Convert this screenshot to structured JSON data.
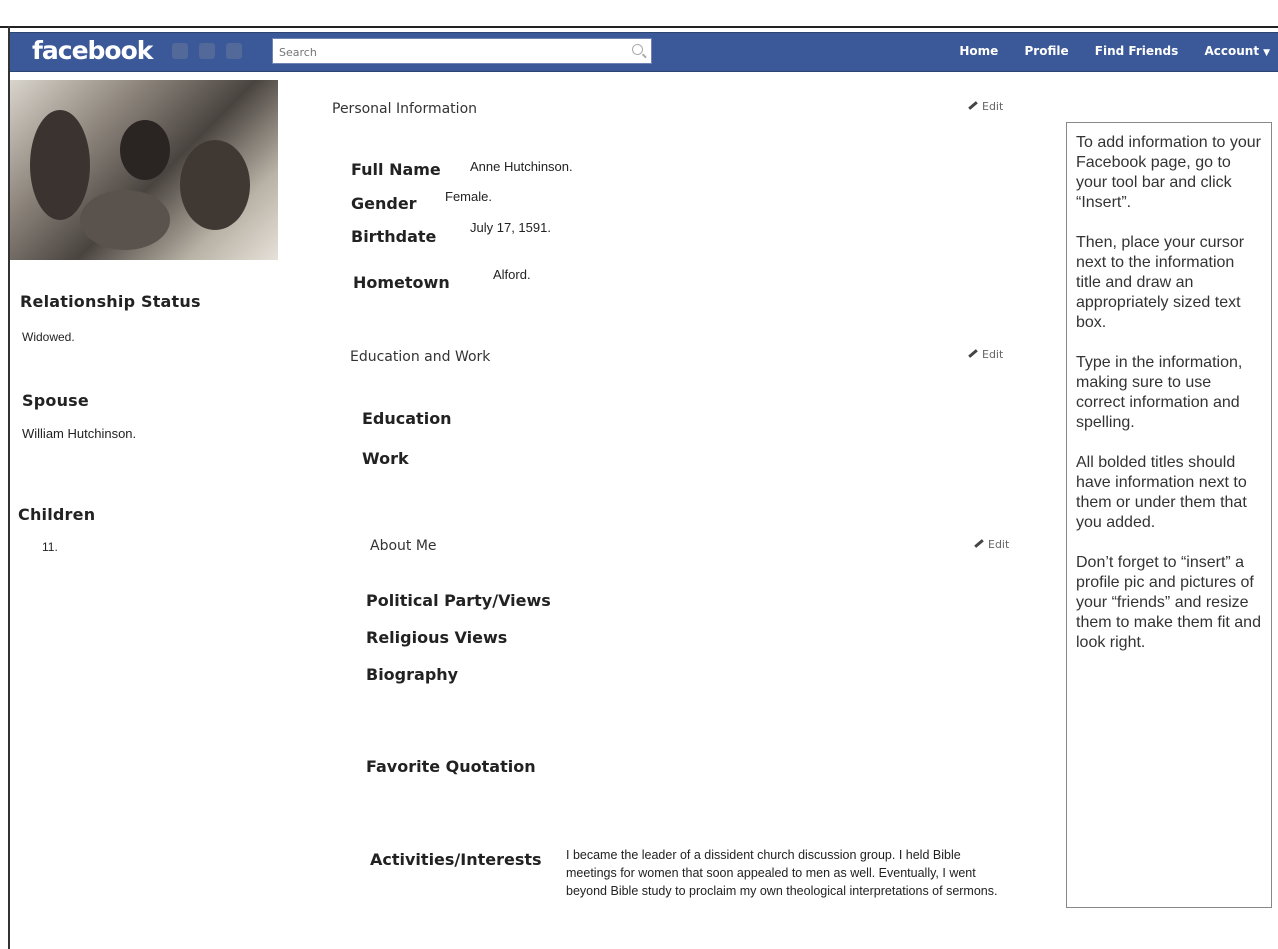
{
  "topbar": {
    "logo": "facebook",
    "search_placeholder": "Search",
    "nav": [
      "Home",
      "Profile",
      "Find Friends",
      "Account"
    ]
  },
  "left": {
    "relationship_label": "Relationship Status",
    "relationship_value": "Widowed.",
    "spouse_label": "Spouse",
    "spouse_value": "William Hutchinson.",
    "children_label": "Children",
    "children_value": "11."
  },
  "personal": {
    "title": "Personal Information",
    "edit": "Edit",
    "full_name_label": "Full Name",
    "full_name_value": "Anne Hutchinson.",
    "gender_label": "Gender",
    "gender_value": "Female.",
    "birthdate_label": "Birthdate",
    "birthdate_value": "July 17, 1591.",
    "hometown_label": "Hometown",
    "hometown_value": "Alford."
  },
  "education": {
    "title": "Education and Work",
    "edit": "Edit",
    "education_label": "Education",
    "work_label": "Work"
  },
  "about": {
    "title": "About Me",
    "edit": "Edit",
    "political_label": "Political Party/Views",
    "religious_label": "Religious Views",
    "biography_label": "Biography",
    "quotation_label": "Favorite Quotation",
    "activities_label": "Activities/Interests",
    "activities_value": "I became the leader of a dissident church discussion group. I held Bible meetings for women that soon appealed to men as well. Eventually, I went beyond Bible study to proclaim my own theological interpretations of sermons."
  },
  "instructions": {
    "p1": "To add information to your Facebook page, go to your tool bar and click “Insert”.",
    "p2": "Then, place your cursor next to the information title and draw an appropriately sized text box.",
    "p3": "Type in the information, making sure to use correct information and spelling.",
    "p4": "All bolded titles should have information next to them or under them that you added.",
    "p5": "Don’t forget to “insert” a profile pic and pictures of your “friends” and resize them to make them fit and look right."
  }
}
